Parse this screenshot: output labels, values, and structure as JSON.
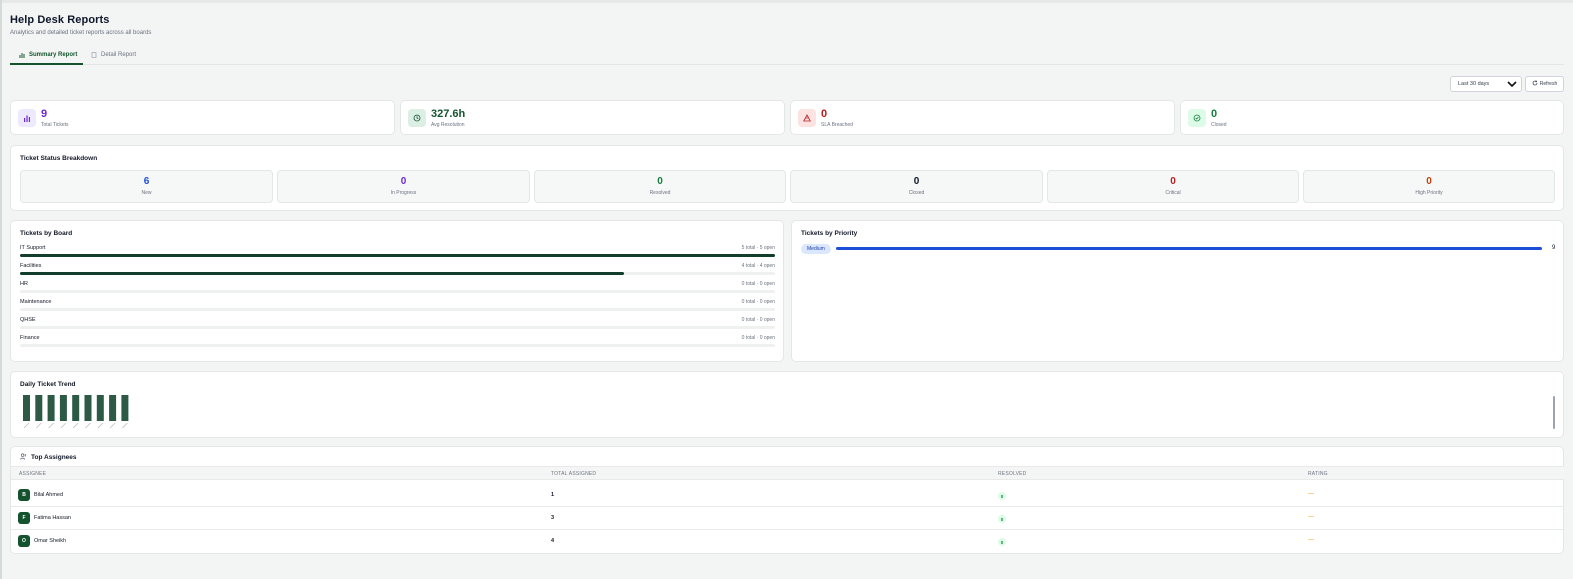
{
  "header": {
    "title": "Help Desk Reports",
    "subtitle": "Analytics and detailed ticket reports across all boards"
  },
  "tabs": [
    {
      "label": "Summary Report",
      "icon": "bar-chart-icon",
      "active": true
    },
    {
      "label": "Detail Report",
      "icon": "document-icon",
      "active": false
    }
  ],
  "controls": {
    "range": "Last 30 days",
    "refresh": "Refresh"
  },
  "stats": [
    {
      "value": "9",
      "label": "Total Tickets",
      "icon": "bar-chart-icon",
      "color": "#6d28d9",
      "bg": "#ede9fe"
    },
    {
      "value": "327.6h",
      "label": "Avg Resolution",
      "icon": "clock-icon",
      "color": "#14532d",
      "bg": "#dcefe5"
    },
    {
      "value": "0",
      "label": "SLA Breached",
      "icon": "warning-icon",
      "color": "#b91c1c",
      "bg": "#fde2e2"
    },
    {
      "value": "0",
      "label": "Closed",
      "icon": "check-circle-icon",
      "color": "#15803d",
      "bg": "#dcfce7"
    }
  ],
  "status_breakdown": {
    "title": "Ticket Status Breakdown",
    "items": [
      {
        "value": "6",
        "label": "New",
        "color": "#1d4ed8"
      },
      {
        "value": "0",
        "label": "In Progress",
        "color": "#6d28d9"
      },
      {
        "value": "0",
        "label": "Resolved",
        "color": "#15803d"
      },
      {
        "value": "0",
        "label": "Closed",
        "color": "#111827"
      },
      {
        "value": "0",
        "label": "Critical",
        "color": "#b91c1c"
      },
      {
        "value": "0",
        "label": "High Priority",
        "color": "#c2410c"
      }
    ]
  },
  "boards": {
    "title": "Tickets by Board",
    "items": [
      {
        "name": "IT Support",
        "meta": "5 total · 5 open",
        "fill": 1.0
      },
      {
        "name": "Facilities",
        "meta": "4 total · 4 open",
        "fill": 0.8
      },
      {
        "name": "HR",
        "meta": "0 total · 0 open",
        "fill": 0
      },
      {
        "name": "Maintenance",
        "meta": "0 total · 0 open",
        "fill": 0
      },
      {
        "name": "QHSE",
        "meta": "0 total · 0 open",
        "fill": 0
      },
      {
        "name": "Finance",
        "meta": "0 total · 0 open",
        "fill": 0
      }
    ]
  },
  "priority": {
    "title": "Tickets by Priority",
    "items": [
      {
        "label": "Medium",
        "count": "9",
        "fill": 1.0
      }
    ]
  },
  "trend": {
    "title": "Daily Ticket Trend",
    "bar_count": 9,
    "bar_color": "#2d5a45"
  },
  "assignees": {
    "title": "Top Assignees",
    "columns": [
      "ASSIGNEE",
      "TOTAL ASSIGNED",
      "RESOLVED",
      "RATING"
    ],
    "rows": [
      {
        "initial": "B",
        "name": "Bilal Ahmed",
        "total": "1",
        "resolved": "0",
        "rating": "—"
      },
      {
        "initial": "F",
        "name": "Fatima Hassan",
        "total": "3",
        "resolved": "0",
        "rating": "—"
      },
      {
        "initial": "O",
        "name": "Omar Sheikh",
        "total": "4",
        "resolved": "0",
        "rating": "—"
      }
    ]
  }
}
